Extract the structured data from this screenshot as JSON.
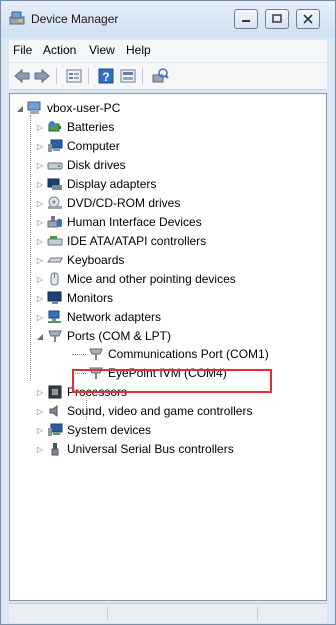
{
  "window": {
    "title": "Device Manager"
  },
  "menu": [
    "File",
    "Action",
    "View",
    "Help"
  ],
  "toolbar": {
    "buttons": [
      "back-icon",
      "forward-icon",
      "properties-icon",
      "help-icon",
      "view-icon",
      "scan-hardware-icon"
    ]
  },
  "tree": {
    "root": "vbox-user-PC",
    "categories": [
      {
        "label": "Batteries",
        "icon": "battery-icon"
      },
      {
        "label": "Computer",
        "icon": "computer-icon"
      },
      {
        "label": "Disk drives",
        "icon": "disk-drive-icon"
      },
      {
        "label": "Display adapters",
        "icon": "display-adapter-icon"
      },
      {
        "label": "DVD/CD-ROM drives",
        "icon": "dvd-drive-icon"
      },
      {
        "label": "Human Interface Devices",
        "icon": "hid-icon"
      },
      {
        "label": "IDE ATA/ATAPI controllers",
        "icon": "ide-controller-icon"
      },
      {
        "label": "Keyboards",
        "icon": "keyboard-icon"
      },
      {
        "label": "Mice and other pointing devices",
        "icon": "mouse-icon"
      },
      {
        "label": "Monitors",
        "icon": "monitor-icon"
      },
      {
        "label": "Network adapters",
        "icon": "network-adapter-icon"
      },
      {
        "label": "Ports (COM & LPT)",
        "icon": "port-icon"
      }
    ],
    "ports_children": [
      {
        "label": "Communications Port (COM1)",
        "icon": "port-icon"
      },
      {
        "label": "EyePoint IVM (COM4)",
        "icon": "port-icon"
      }
    ],
    "categories_after": [
      {
        "label": "Processors",
        "icon": "processor-icon"
      },
      {
        "label": "Sound, video and game controllers",
        "icon": "sound-icon"
      },
      {
        "label": "System devices",
        "icon": "system-device-icon"
      },
      {
        "label": "Universal Serial Bus controllers",
        "icon": "usb-icon"
      }
    ]
  }
}
